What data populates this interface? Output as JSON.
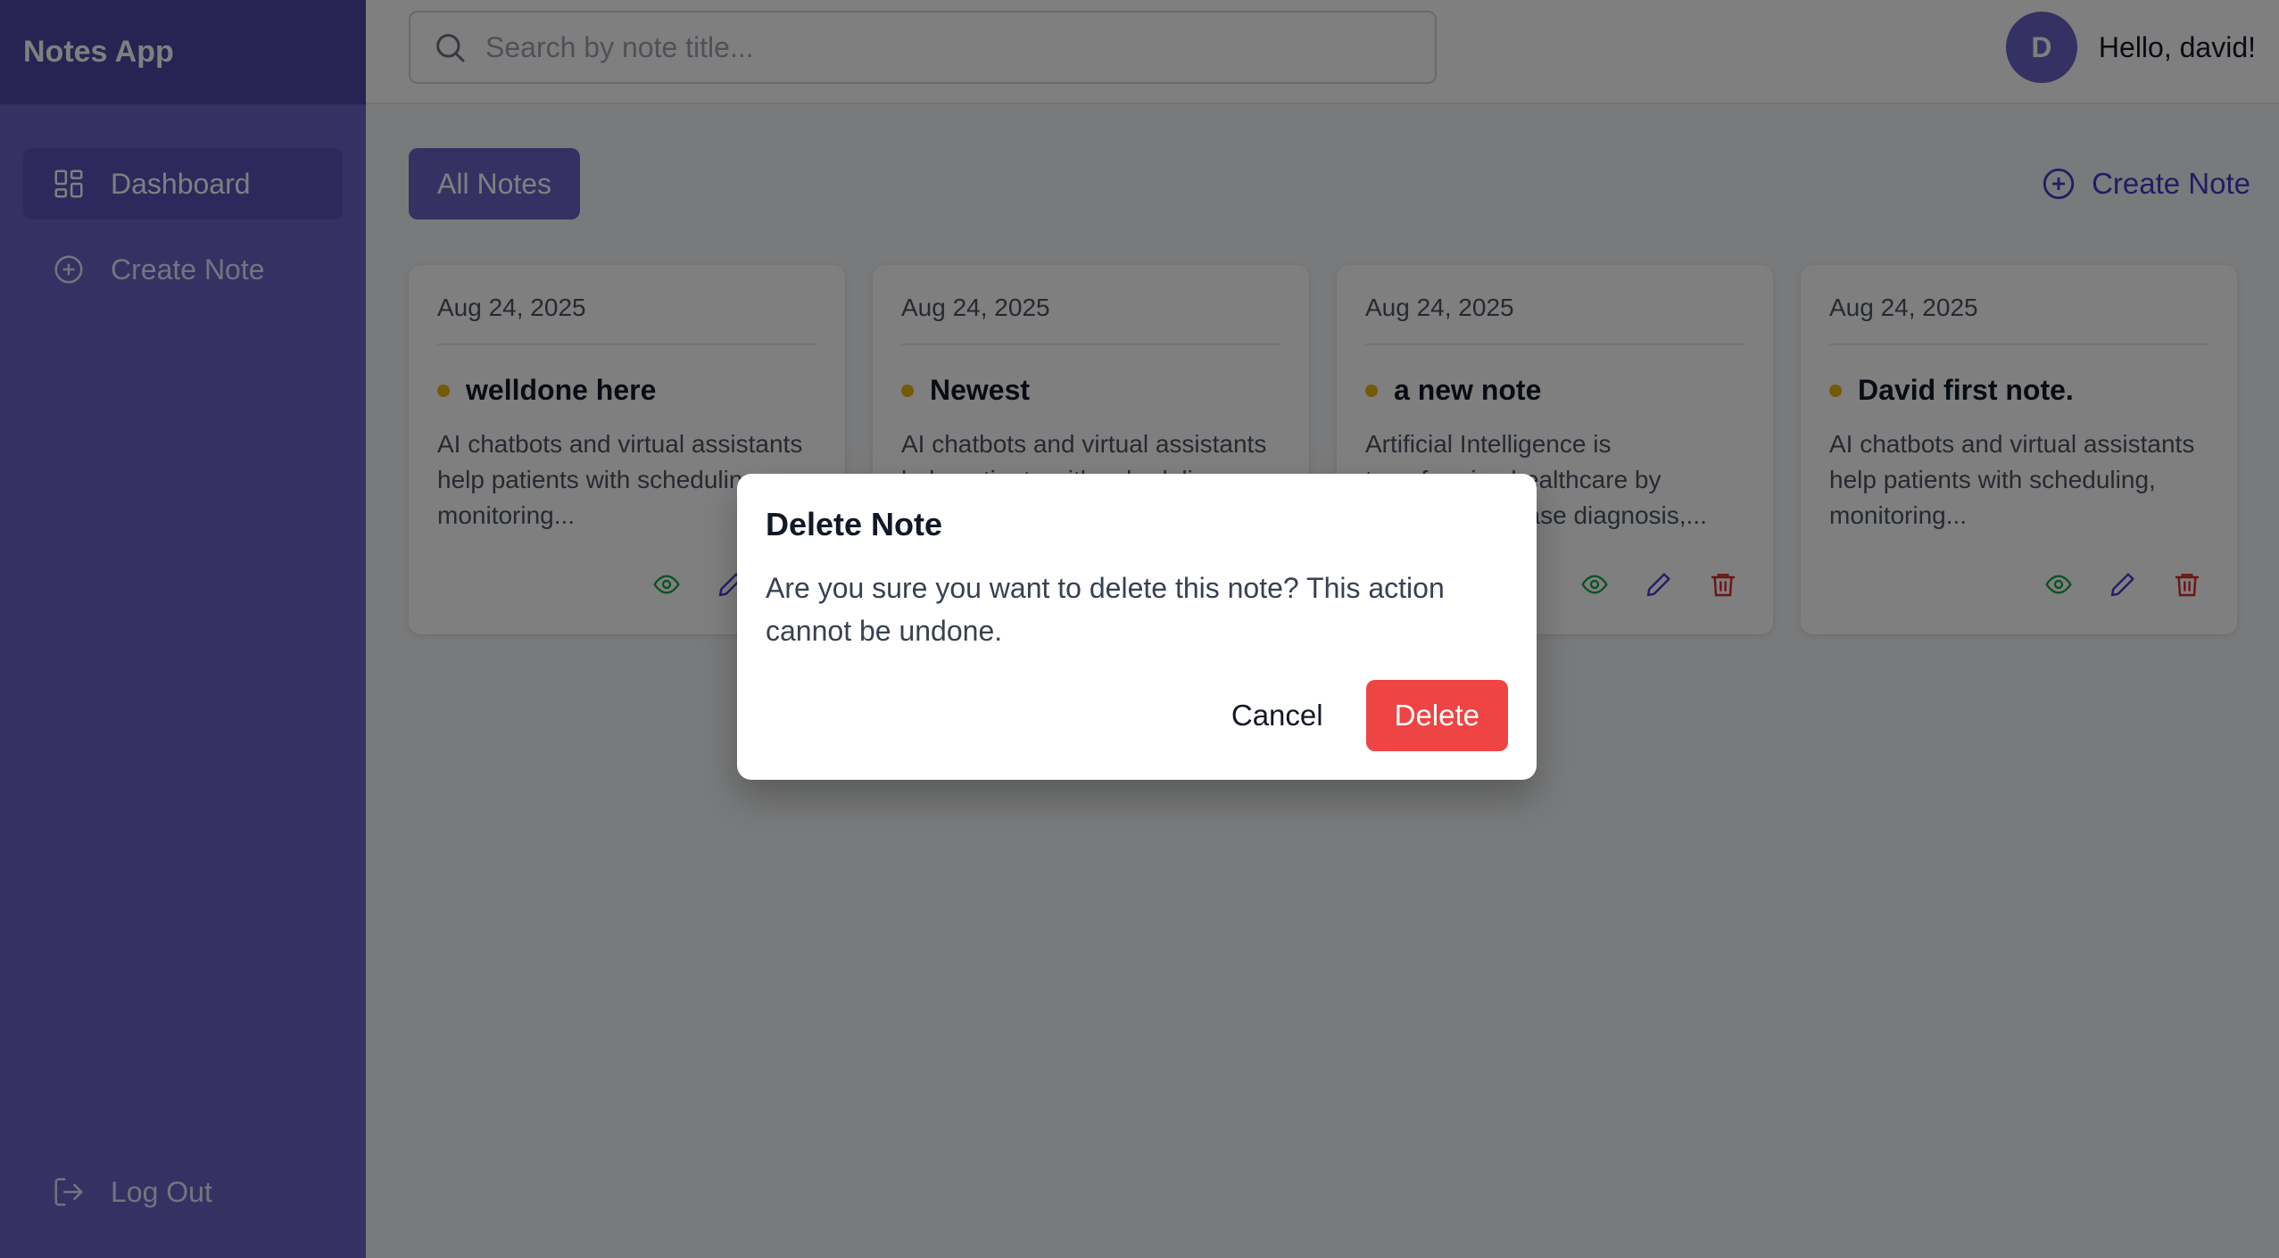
{
  "app": {
    "title": "Notes App"
  },
  "sidebar": {
    "items": [
      {
        "label": "Dashboard",
        "icon": "grid-icon",
        "active": true
      },
      {
        "label": "Create Note",
        "icon": "plus-circle-icon",
        "active": false
      }
    ],
    "logout_label": "Log Out"
  },
  "topbar": {
    "search_placeholder": "Search by note title...",
    "avatar_initial": "D",
    "greeting": "Hello, david!"
  },
  "main": {
    "tab_all_label": "All Notes",
    "create_label": "Create Note",
    "notes": [
      {
        "date": "Aug 24, 2025",
        "title": "welldone here",
        "body": "AI chatbots and virtual assistants help patients with scheduling, monitoring..."
      },
      {
        "date": "Aug 24, 2025",
        "title": "Newest",
        "body": "AI chatbots and virtual assistants help patients with scheduling, monitoring..."
      },
      {
        "date": "Aug 24, 2025",
        "title": "a new note",
        "body": "Artificial Intelligence is transforming healthcare by improving disease diagnosis,..."
      },
      {
        "date": "Aug 24, 2025",
        "title": "David first note.",
        "body": "AI chatbots and virtual assistants help patients with scheduling, monitoring..."
      }
    ]
  },
  "modal": {
    "title": "Delete Note",
    "message": "Are you sure you want to delete this note? This action cannot be undone.",
    "cancel_label": "Cancel",
    "delete_label": "Delete"
  },
  "colors": {
    "brand": "#6b63c4",
    "brand_dark": "#4f46a5",
    "danger": "#ef4444",
    "view": "#16a34a",
    "edit": "#4338ca",
    "dot": "#eab308"
  }
}
